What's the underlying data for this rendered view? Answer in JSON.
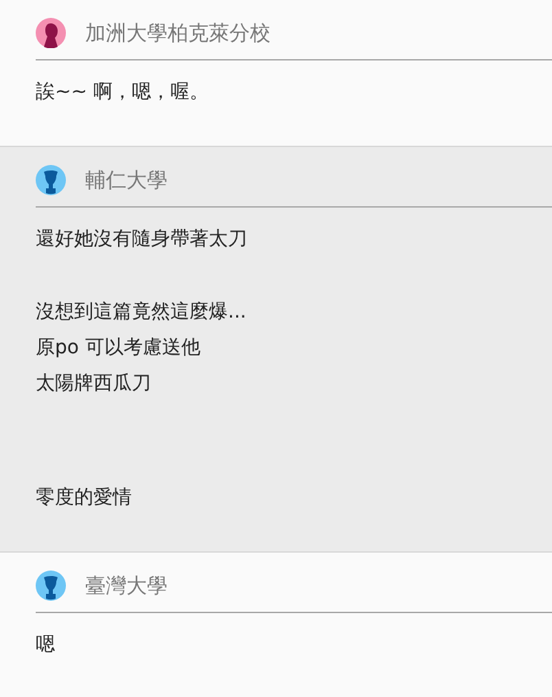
{
  "comments": [
    {
      "school": "加洲大學柏克萊分校",
      "kind": "female",
      "highlighted": false,
      "paragraphs": [
        [
          "誒~~ 啊，嗯，喔。"
        ]
      ]
    },
    {
      "school": "輔仁大學",
      "kind": "male",
      "highlighted": true,
      "paragraphs": [
        [
          "還好她沒有隨身帶著太刀"
        ],
        [
          "沒想到這篇竟然這麼爆...",
          "原po 可以考慮送他",
          "太陽牌西瓜刀"
        ],
        [
          "零度的愛情"
        ]
      ]
    },
    {
      "school": "臺灣大學",
      "kind": "male",
      "highlighted": false,
      "paragraphs": [
        [
          "嗯"
        ]
      ]
    }
  ]
}
